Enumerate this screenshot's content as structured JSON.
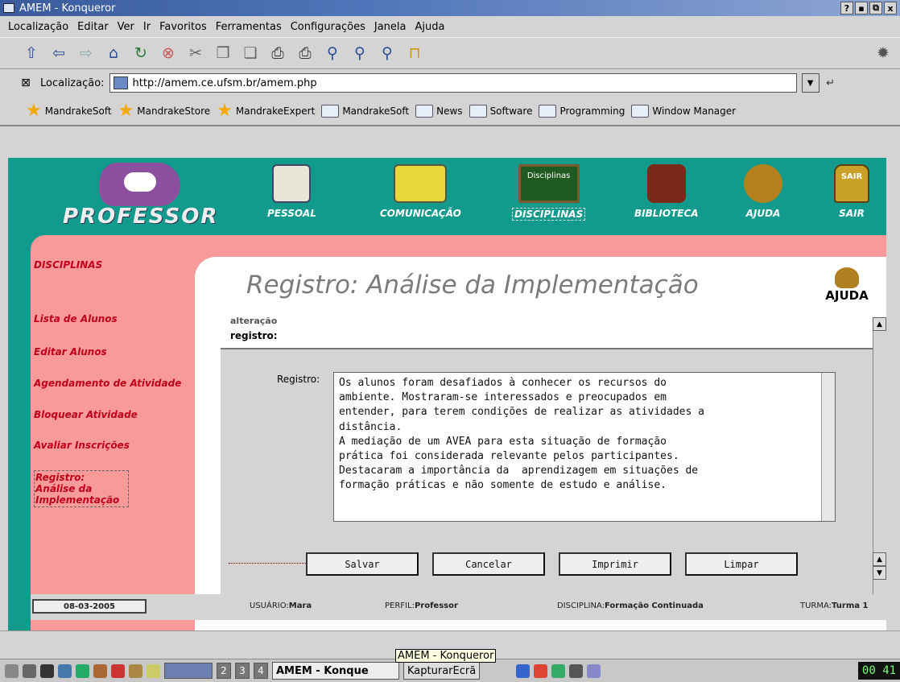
{
  "window": {
    "title": "AMEM - Konqueror",
    "buttons": [
      "?",
      "▪",
      "⧉",
      "x"
    ]
  },
  "menu": [
    "Localização",
    "Editar",
    "Ver",
    "Ir",
    "Favoritos",
    "Ferramentas",
    "Configurações",
    "Janela",
    "Ajuda"
  ],
  "toolbar_icons": [
    "up-icon",
    "back-icon",
    "forward-icon",
    "home-icon",
    "reload-icon",
    "stop-icon",
    "cut-icon",
    "copy-icon",
    "paste-icon",
    "print-icon",
    "print-frame-icon",
    "zoom-icon",
    "zoom-in-icon",
    "zoom-out-icon",
    "lock-icon"
  ],
  "location": {
    "label": "Localização:",
    "url": "http://amem.ce.ufsm.br/amem.php"
  },
  "bookmarks": [
    {
      "label": "MandrakeSoft",
      "icon": "star-icon"
    },
    {
      "label": "MandrakeStore",
      "icon": "star-icon"
    },
    {
      "label": "MandrakeExpert",
      "icon": "star-icon"
    },
    {
      "label": "MandrakeSoft",
      "icon": "folder-icon"
    },
    {
      "label": "News",
      "icon": "folder-icon"
    },
    {
      "label": "Software",
      "icon": "folder-icon"
    },
    {
      "label": "Programming",
      "icon": "folder-icon"
    },
    {
      "label": "Window Manager",
      "icon": "folder-icon"
    }
  ],
  "site": {
    "logo": "PROFESSOR",
    "nav": [
      {
        "label": "PESSOAL"
      },
      {
        "label": "COMUNICAÇÃO"
      },
      {
        "label": "DISCIPLINAS",
        "badge": "Disciplinas"
      },
      {
        "label": "BIBLIOTECA"
      },
      {
        "label": "AJUDA"
      },
      {
        "label": "SAIR",
        "badge": "SAIR"
      }
    ]
  },
  "sidebar": {
    "heading": "DISCIPLINAS",
    "items": [
      "Lista de Alunos",
      "Editar Alunos",
      "Agendamento de Atividade",
      "Bloquear Atividade",
      "Avaliar Inscrições",
      "Registro: Análise da Implementação"
    ]
  },
  "page": {
    "title": "Registro: Análise da Implementação",
    "help": "AJUDA"
  },
  "form": {
    "cut_label": "alteração",
    "reg_label": "registro:",
    "field_label": "Registro:",
    "text": "Os alunos foram desafiados à conhecer os recursos do\nambiente. Mostraram-se interessados e preocupados em\nentender, para terem condições de realizar as atividades a\ndistância.\nA mediação de um AVEA para esta situação de formação\nprática foi considerada relevante pelos participantes.\nDestacaram a importância da  aprendizagem em situações de\nformação práticas e não somente de estudo e análise.",
    "buttons": [
      "Salvar",
      "Cancelar",
      "Imprimir",
      "Limpar"
    ]
  },
  "status": {
    "date": "08-03-2005",
    "usuario_k": "USUÁRIO:",
    "usuario": "Mara",
    "perfil_k": "PERFIL:",
    "perfil": "Professor",
    "disc_k": "DISCIPLINA:",
    "disc": "Formação Continuada",
    "turma_k": "TURMA:",
    "turma": "Turma 1"
  },
  "taskbar": {
    "desktops": [
      "2",
      "3",
      "4"
    ],
    "tasks": [
      "AMEM - Konque",
      "KapturarEcrã"
    ],
    "tooltip": "AMEM - Konqueror",
    "clock": "00 41"
  },
  "colors": {
    "teal": "#129a8c",
    "pink": "#f89a9a",
    "sidebar_text": "#c0001a"
  }
}
